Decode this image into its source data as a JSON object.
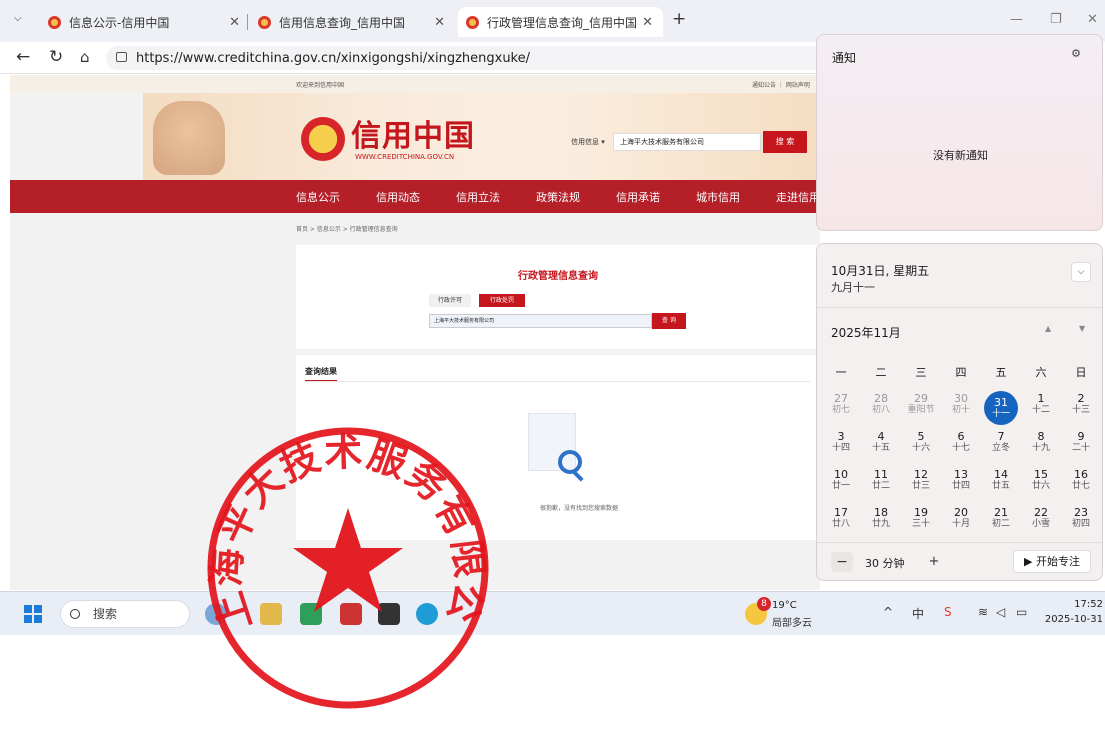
{
  "tabs": [
    {
      "title": "信息公示-信用中国"
    },
    {
      "title": "信用信息查询_信用中国"
    },
    {
      "title": "行政管理信息查询_信用中国"
    }
  ],
  "address": {
    "url": "https://www.creditchina.gov.cn/xinxigongshi/xingzhengxuke/"
  },
  "site": {
    "top_left": "欢迎来到信用中国",
    "top_right": "通知公告 ｜ 网站声明",
    "logo_cn": "信用中国",
    "logo_en": "WWW.CREDITCHINA.GOV.CN",
    "search_scope": "信用信息 ▾",
    "search_value": "上海平大技术服务有限公司",
    "search_button": "搜 索",
    "nav": [
      "信息公示",
      "信用动态",
      "信用立法",
      "政策法规",
      "信用承诺",
      "城市信用",
      "走进信用"
    ],
    "breadcrumb": "首页 > 信息公示 > 行政管理信息查询",
    "query_title": "行政管理信息查询",
    "query_tabs": [
      "行政许可",
      "行政处罚"
    ],
    "query_value": "上海平大技术服务有限公司",
    "query_button": "查 询",
    "results_title": "查询结果",
    "empty_text": "很抱歉，没有找到您搜索数据"
  },
  "notification": {
    "title": "通知",
    "empty": "没有新通知"
  },
  "calendar": {
    "date": "10月31日, 星期五",
    "lunar": "九月十一",
    "month": "2025年11月",
    "weekdays": [
      "一",
      "二",
      "三",
      "四",
      "五",
      "六",
      "日"
    ],
    "weeks": [
      [
        {
          "d": "27",
          "l": "初七",
          "other": true
        },
        {
          "d": "28",
          "l": "初八",
          "other": true
        },
        {
          "d": "29",
          "l": "重阳节",
          "other": true
        },
        {
          "d": "30",
          "l": "初十",
          "other": true
        },
        {
          "d": "31",
          "l": "十一",
          "other": true,
          "today": true
        },
        {
          "d": "1",
          "l": "十二"
        },
        {
          "d": "2",
          "l": "十三"
        }
      ],
      [
        {
          "d": "3",
          "l": "十四"
        },
        {
          "d": "4",
          "l": "十五"
        },
        {
          "d": "5",
          "l": "十六"
        },
        {
          "d": "6",
          "l": "十七"
        },
        {
          "d": "7",
          "l": "立冬"
        },
        {
          "d": "8",
          "l": "十九"
        },
        {
          "d": "9",
          "l": "二十"
        }
      ],
      [
        {
          "d": "10",
          "l": "廿一"
        },
        {
          "d": "11",
          "l": "廿二"
        },
        {
          "d": "12",
          "l": "廿三"
        },
        {
          "d": "13",
          "l": "廿四"
        },
        {
          "d": "14",
          "l": "廿五"
        },
        {
          "d": "15",
          "l": "廿六"
        },
        {
          "d": "16",
          "l": "廿七"
        }
      ],
      [
        {
          "d": "17",
          "l": "廿八"
        },
        {
          "d": "18",
          "l": "廿九"
        },
        {
          "d": "19",
          "l": "三十"
        },
        {
          "d": "20",
          "l": "十月"
        },
        {
          "d": "21",
          "l": "初二"
        },
        {
          "d": "22",
          "l": "小雪"
        },
        {
          "d": "23",
          "l": "初四"
        }
      ]
    ],
    "focus_minutes": "30 分钟",
    "focus_start": "▶ 开始专注"
  },
  "taskbar": {
    "search": "搜索",
    "weather_badge": "8",
    "temp": "19°C",
    "weather": "局部多云",
    "time": "17:52",
    "date": "2025-10-31"
  },
  "stamp": {
    "text": "上海平大技术服务有限公司"
  },
  "colors": {
    "brand_red": "#c4161c",
    "nav_red": "#b51f28",
    "today_blue": "#1565c0",
    "stamp_red": "#e3141b"
  }
}
